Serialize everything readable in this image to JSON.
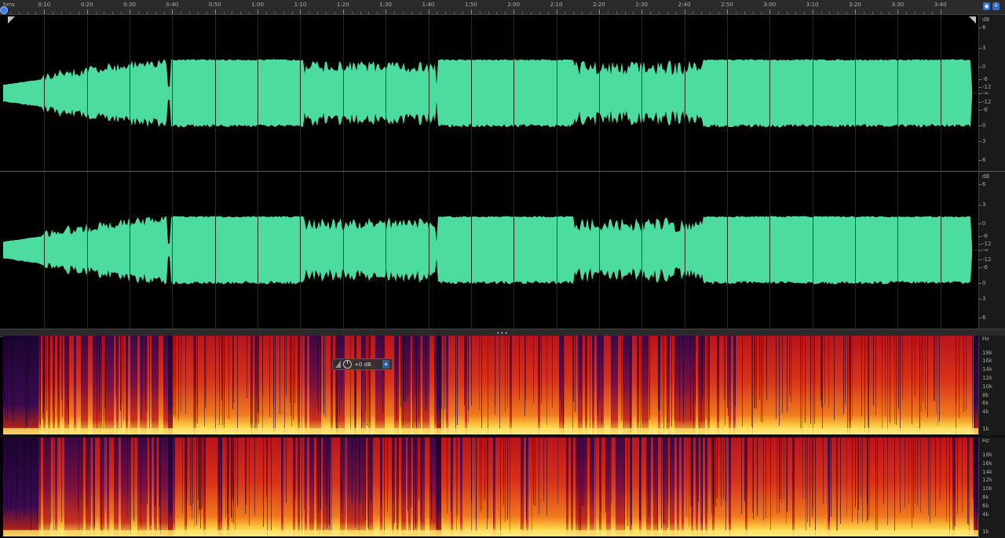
{
  "timeline": {
    "unit_label": "hms",
    "markers": [
      "0:10",
      "0:20",
      "0:30",
      "0:40",
      "0:50",
      "1:00",
      "1:10",
      "1:20",
      "1:30",
      "1:40",
      "1:50",
      "2:00",
      "2:10",
      "2:20",
      "2:30",
      "2:40",
      "2:50",
      "3:00",
      "3:10",
      "3:20",
      "3:30",
      "3:40"
    ]
  },
  "amplitude_scale": {
    "unit": "dB",
    "labels": [
      "6",
      "3",
      "0",
      "-6",
      "-12",
      "-∞",
      "-12",
      "-6",
      "0",
      "3",
      "6"
    ]
  },
  "spectral_scale": {
    "unit": "Hz",
    "labels": [
      "18k",
      "16k",
      "14k",
      "12k",
      "10k",
      "8k",
      "6k",
      "4k",
      "1k"
    ]
  },
  "hud": {
    "volume_value": "+0 dB"
  },
  "colors": {
    "waveform": "#4ddca0",
    "accent": "#3b82f6",
    "spectral_low": "#1a0530",
    "spectral_mid": "#c8201a",
    "spectral_high": "#ffd84a"
  },
  "icons": {
    "playhead": "playhead-marker-icon",
    "hud_level": "level-icon",
    "hud_knob": "volume-knob-icon",
    "hud_pin": "pin-icon"
  }
}
